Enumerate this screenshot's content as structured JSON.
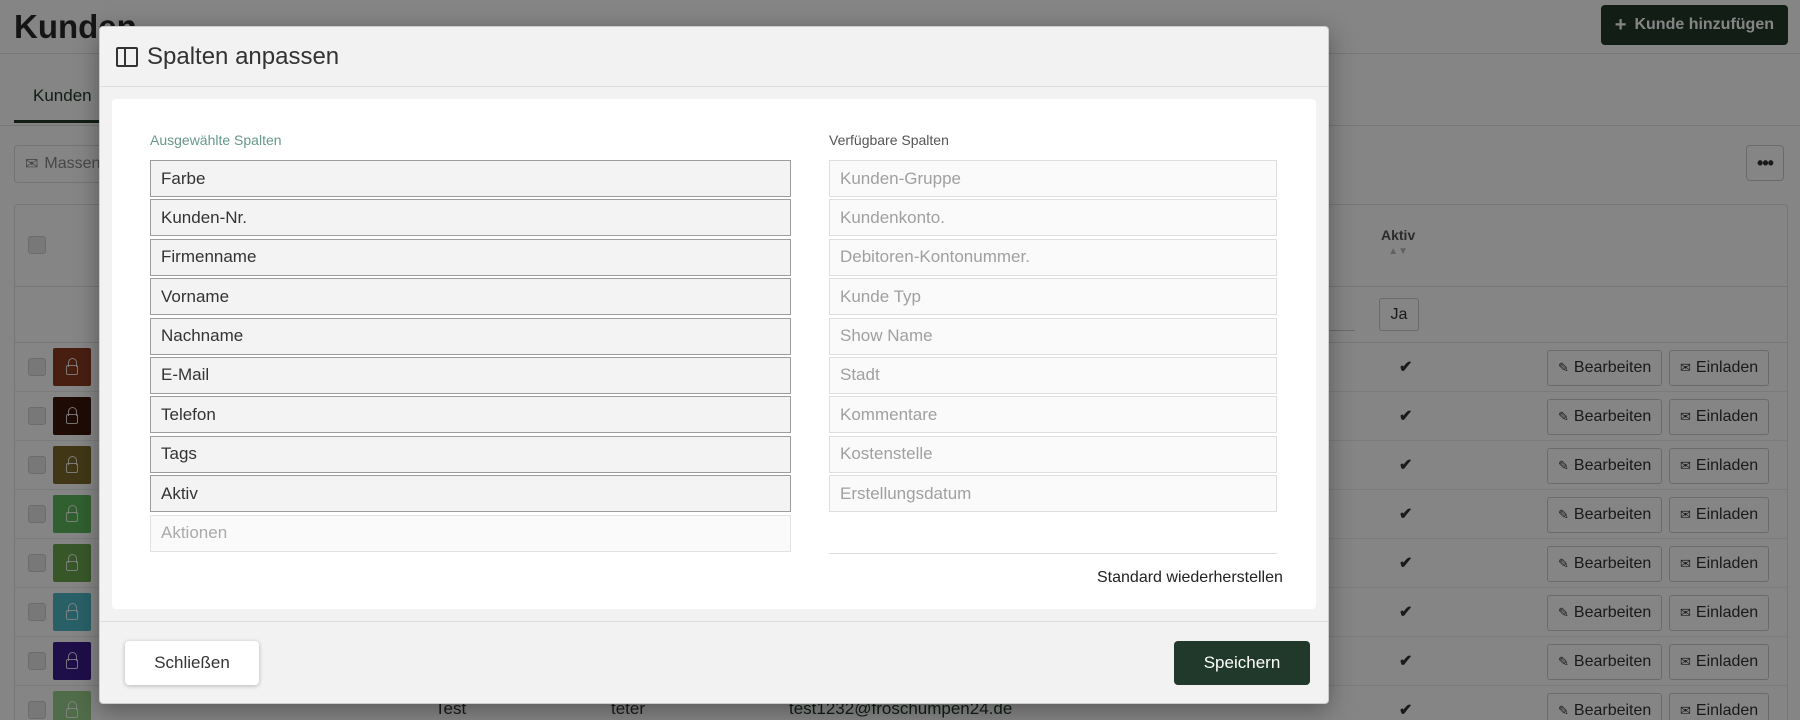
{
  "page": {
    "title": "Kunden",
    "add_button_label": "Kunde hinzufügen",
    "tab_label": "Kunden",
    "toolbar_label": "Massen",
    "table": {
      "aktiv_header": "Aktiv",
      "filter_ja": "Ja",
      "edit_label": "Bearbeiten",
      "invite_label": "Einladen",
      "avatar_colors": [
        "#8a3a22",
        "#3a160c",
        "#7d6a2c",
        "#5cb85c",
        "#6aa84f",
        "#4fb8c8",
        "#3a1c8c",
        "#9ccf8a"
      ],
      "last_row": {
        "name": "Test",
        "vorname": "teter",
        "email": "test1232@froschumpen24.de"
      }
    }
  },
  "modal": {
    "title": "Spalten anpassen",
    "selected_heading": "Ausgewählte Spalten",
    "available_heading": "Verfügbare Spalten",
    "selected_columns": [
      "Farbe",
      "Kunden-Nr.",
      "Firmenname",
      "Vorname",
      "Nachname",
      "E-Mail",
      "Telefon",
      "Tags",
      "Aktiv"
    ],
    "selected_placeholder": "Aktionen",
    "available_columns": [
      "Kunden-Gruppe",
      "Kundenkonto.",
      "Debitoren-Kontonummer.",
      "Kunde Typ",
      "Show Name",
      "Stadt",
      "Kommentare",
      "Kostenstelle",
      "Erstellungsdatum"
    ],
    "restore_label": "Standard wiederherstellen",
    "close_label": "Schließen",
    "save_label": "Speichern"
  },
  "colors": {
    "primary": "#21392a",
    "selected_heading": "#66988a"
  }
}
